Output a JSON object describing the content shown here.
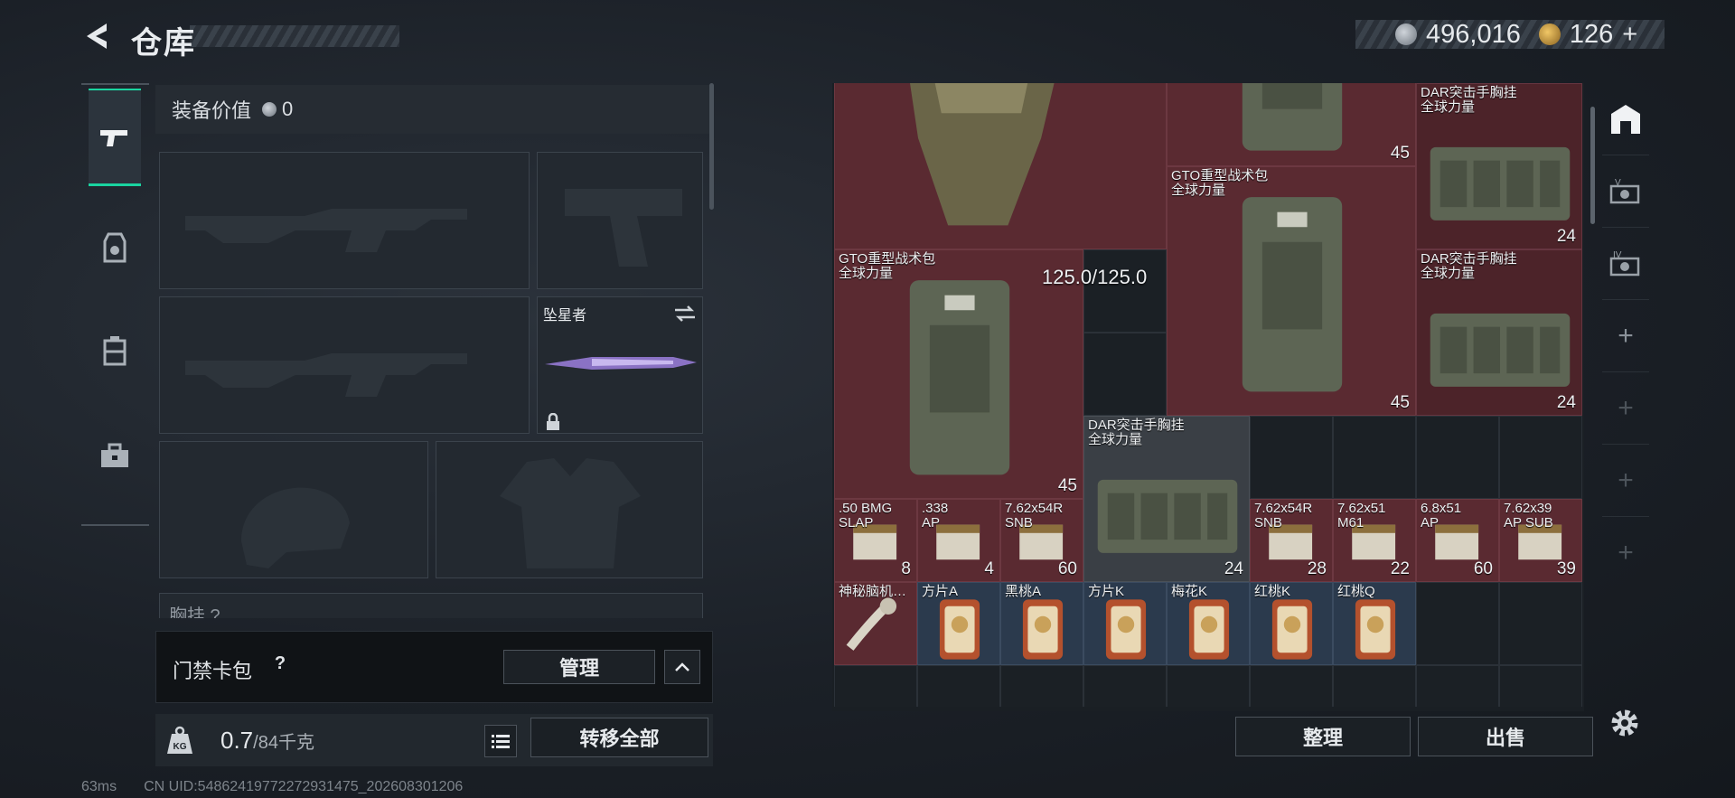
{
  "header": {
    "title": "仓库",
    "back_icon": "back-arrow-icon",
    "currency": {
      "silver_amount": "496,016",
      "silver_icon": "silver-coin-icon",
      "gold_amount": "126",
      "gold_icon": "gold-coin-icon",
      "add_symbol": "+"
    }
  },
  "rail": {
    "items": [
      {
        "name": "weapons",
        "icon": "pistol-icon",
        "active": true
      },
      {
        "name": "gear",
        "icon": "gear-bag-icon",
        "active": false
      },
      {
        "name": "backpack",
        "icon": "backpack-icon",
        "active": false
      },
      {
        "name": "toolbox",
        "icon": "toolbox-icon",
        "active": false
      }
    ]
  },
  "equipment": {
    "value_label": "装备价值",
    "value_amount": "0",
    "melee_name": "坠星者",
    "chest_label": "胸挂 ?"
  },
  "keycard": {
    "label": "门禁卡包",
    "help": "?",
    "manage_label": "管理"
  },
  "weight": {
    "current": "0.7",
    "max": "/84千克",
    "icon": "kg-weight-icon",
    "transfer_label": "转移全部"
  },
  "status": {
    "ping": "63ms",
    "uid": "CN UID:548624197722729314​75_202608301206"
  },
  "stash": {
    "durability": "125.0/125.0",
    "items": [
      {
        "name": "",
        "count": "",
        "top": "24"
      },
      {
        "name": "",
        "count": "45"
      },
      {
        "name": "DAR突击手胸挂\n全球力量",
        "count": "24"
      },
      {
        "name": "GTO重型战术包\n全球力量",
        "count": "45"
      },
      {
        "name": "DAR突击手胸挂\n全球力量",
        "count": "24"
      },
      {
        "name": "GTO重型战术包\n全球力量",
        "count": "45"
      },
      {
        "name": "DAR突击手胸挂\n全球力量",
        "count": "24"
      },
      {
        "name": ".50 BMG\nSLAP",
        "count": "8"
      },
      {
        "name": ".338\nAP",
        "count": "4"
      },
      {
        "name": "7.62x54R\nSNB",
        "count": "60"
      },
      {
        "name": "7.62x54R\nSNB",
        "count": "28"
      },
      {
        "name": "7.62x51\nM61",
        "count": "22"
      },
      {
        "name": "6.8x51\nAP",
        "count": "60"
      },
      {
        "name": "7.62x39\nAP SUB",
        "count": "39"
      },
      {
        "name": "神秘脑机…",
        "count": ""
      },
      {
        "name": "方片A",
        "count": ""
      },
      {
        "name": "黑桃A",
        "count": ""
      },
      {
        "name": "方片K",
        "count": ""
      },
      {
        "name": "梅花K",
        "count": ""
      },
      {
        "name": "红桃K",
        "count": ""
      },
      {
        "name": "红桃Q",
        "count": ""
      }
    ],
    "sort_label": "整理",
    "sell_label": "出售"
  },
  "tools": {
    "icons": [
      "storage-icon",
      "container-v-icon",
      "container-iv-icon"
    ],
    "add_symbol": "+",
    "settings_icon": "settings-gear-icon"
  },
  "colors": {
    "accent": "#1ad4a0",
    "item_red": "#5a2a31",
    "item_blue": "#2b3a4d"
  }
}
